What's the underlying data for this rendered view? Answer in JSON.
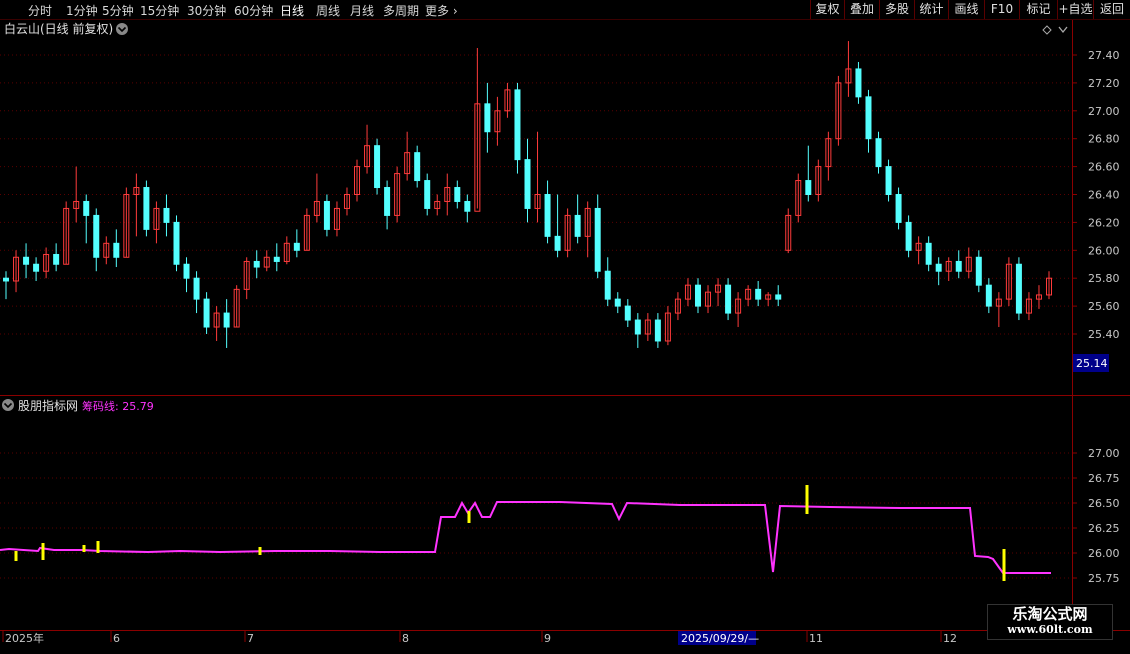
{
  "timeframes": [
    {
      "label": "分时",
      "active": false
    },
    {
      "label": "1分钟",
      "active": false
    },
    {
      "label": "5分钟",
      "active": false
    },
    {
      "label": "15分钟",
      "active": false
    },
    {
      "label": "30分钟",
      "active": false
    },
    {
      "label": "60分钟",
      "active": false
    },
    {
      "label": "日线",
      "active": true
    },
    {
      "label": "周线",
      "active": false
    },
    {
      "label": "月线",
      "active": false
    },
    {
      "label": "多周期",
      "active": false
    },
    {
      "label": "更多",
      "active": false
    }
  ],
  "toolbar": [
    "复权",
    "叠加",
    "多股",
    "统计",
    "画线",
    "F10",
    "标记",
    "+自选",
    "返回"
  ],
  "main_panel": {
    "title": "白云山(日线 前复权)",
    "price_tag": "25.14"
  },
  "indicator_panel": {
    "name": "股朋指标网",
    "series_label": "筹码线: 25.79"
  },
  "x_axis": {
    "labels": [
      "2025年",
      "6",
      "7",
      "8",
      "9",
      "2025/09/29/—",
      "11",
      "12"
    ]
  },
  "watermark": {
    "title": "乐淘公式网",
    "url": "www.60lt.com"
  },
  "colors": {
    "up": "#ff3b3b",
    "down": "#54ffff",
    "line": "#ff33ff",
    "signal": "#ffff00",
    "grid": "#5a0000"
  },
  "chart_data": [
    {
      "type": "candlestick",
      "title": "白云山(日线 前复权)",
      "y_ticks": [
        "25.40",
        "25.60",
        "25.80",
        "26.00",
        "26.20",
        "26.40",
        "26.60",
        "26.80",
        "27.00",
        "27.20",
        "27.40"
      ],
      "ylim": [
        25.14,
        27.55
      ],
      "candles": [
        [
          25.8,
          25.85,
          25.65,
          25.78
        ],
        [
          25.78,
          26.0,
          25.7,
          25.95
        ],
        [
          25.95,
          26.05,
          25.8,
          25.9
        ],
        [
          25.9,
          25.95,
          25.78,
          25.85
        ],
        [
          25.85,
          26.02,
          25.8,
          25.97
        ],
        [
          25.97,
          26.05,
          25.85,
          25.9
        ],
        [
          25.9,
          26.35,
          25.9,
          26.3
        ],
        [
          26.3,
          26.6,
          26.2,
          26.35
        ],
        [
          26.35,
          26.4,
          26.05,
          26.25
        ],
        [
          26.25,
          26.3,
          25.85,
          25.95
        ],
        [
          25.95,
          26.1,
          25.9,
          26.05
        ],
        [
          26.05,
          26.15,
          25.88,
          25.95
        ],
        [
          25.95,
          26.45,
          25.95,
          26.4
        ],
        [
          26.4,
          26.55,
          26.1,
          26.45
        ],
        [
          26.45,
          26.5,
          26.1,
          26.15
        ],
        [
          26.15,
          26.35,
          26.05,
          26.3
        ],
        [
          26.3,
          26.4,
          26.1,
          26.2
        ],
        [
          26.2,
          26.25,
          25.85,
          25.9
        ],
        [
          25.9,
          25.95,
          25.7,
          25.8
        ],
        [
          25.8,
          25.85,
          25.55,
          25.65
        ],
        [
          25.65,
          25.7,
          25.4,
          25.45
        ],
        [
          25.45,
          25.6,
          25.35,
          25.55
        ],
        [
          25.55,
          25.65,
          25.3,
          25.45
        ],
        [
          25.45,
          25.75,
          25.45,
          25.72
        ],
        [
          25.72,
          25.95,
          25.65,
          25.92
        ],
        [
          25.92,
          26.0,
          25.8,
          25.88
        ],
        [
          25.88,
          26.0,
          25.85,
          25.95
        ],
        [
          25.95,
          26.05,
          25.85,
          25.92
        ],
        [
          25.92,
          26.1,
          25.9,
          26.05
        ],
        [
          26.05,
          26.15,
          25.95,
          26.0
        ],
        [
          26.0,
          26.3,
          26.0,
          26.25
        ],
        [
          26.25,
          26.55,
          26.2,
          26.35
        ],
        [
          26.35,
          26.4,
          26.1,
          26.15
        ],
        [
          26.15,
          26.35,
          26.1,
          26.3
        ],
        [
          26.3,
          26.45,
          26.25,
          26.4
        ],
        [
          26.4,
          26.65,
          26.35,
          26.6
        ],
        [
          26.6,
          26.9,
          26.55,
          26.75
        ],
        [
          26.75,
          26.8,
          26.4,
          26.45
        ],
        [
          26.45,
          26.5,
          26.15,
          26.25
        ],
        [
          26.25,
          26.6,
          26.2,
          26.55
        ],
        [
          26.55,
          26.85,
          26.5,
          26.7
        ],
        [
          26.7,
          26.75,
          26.45,
          26.5
        ],
        [
          26.5,
          26.55,
          26.25,
          26.3
        ],
        [
          26.3,
          26.4,
          26.25,
          26.35
        ],
        [
          26.35,
          26.55,
          26.25,
          26.45
        ],
        [
          26.45,
          26.5,
          26.3,
          26.35
        ],
        [
          26.35,
          26.4,
          26.2,
          26.28
        ],
        [
          26.28,
          27.45,
          26.3,
          27.05
        ],
        [
          27.05,
          27.2,
          26.7,
          26.85
        ],
        [
          26.85,
          27.1,
          26.75,
          27.0
        ],
        [
          27.0,
          27.2,
          26.95,
          27.15
        ],
        [
          27.15,
          27.2,
          26.55,
          26.65
        ],
        [
          26.65,
          26.8,
          26.2,
          26.3
        ],
        [
          26.3,
          26.85,
          26.2,
          26.4
        ],
        [
          26.4,
          26.5,
          26.05,
          26.1
        ],
        [
          26.1,
          26.4,
          25.95,
          26.0
        ],
        [
          26.0,
          26.3,
          25.95,
          26.25
        ],
        [
          26.25,
          26.4,
          26.05,
          26.1
        ],
        [
          26.1,
          26.35,
          25.95,
          26.3
        ],
        [
          26.3,
          26.4,
          25.8,
          25.85
        ],
        [
          25.85,
          25.95,
          25.6,
          25.65
        ],
        [
          25.65,
          25.7,
          25.55,
          25.6
        ],
        [
          25.6,
          25.65,
          25.45,
          25.5
        ],
        [
          25.5,
          25.55,
          25.3,
          25.4
        ],
        [
          25.4,
          25.55,
          25.35,
          25.5
        ],
        [
          25.5,
          25.55,
          25.3,
          25.35
        ],
        [
          25.35,
          25.6,
          25.32,
          25.55
        ],
        [
          25.55,
          25.7,
          25.5,
          25.65
        ],
        [
          25.65,
          25.8,
          25.6,
          25.75
        ],
        [
          25.75,
          25.8,
          25.55,
          25.6
        ],
        [
          25.6,
          25.75,
          25.55,
          25.7
        ],
        [
          25.7,
          25.8,
          25.6,
          25.75
        ],
        [
          25.75,
          25.8,
          25.5,
          25.55
        ],
        [
          25.55,
          25.7,
          25.45,
          25.65
        ],
        [
          25.65,
          25.75,
          25.6,
          25.72
        ],
        [
          25.72,
          25.78,
          25.6,
          25.65
        ],
        [
          25.65,
          25.7,
          25.6,
          25.68
        ],
        [
          25.68,
          25.75,
          25.6,
          25.65
        ],
        [
          26.0,
          26.3,
          25.98,
          26.25
        ],
        [
          26.25,
          26.55,
          26.2,
          26.5
        ],
        [
          26.5,
          26.75,
          26.35,
          26.4
        ],
        [
          26.4,
          26.65,
          26.35,
          26.6
        ],
        [
          26.6,
          26.85,
          26.5,
          26.8
        ],
        [
          26.8,
          27.25,
          26.75,
          27.2
        ],
        [
          27.2,
          27.5,
          27.1,
          27.3
        ],
        [
          27.3,
          27.35,
          27.05,
          27.1
        ],
        [
          27.1,
          27.15,
          26.7,
          26.8
        ],
        [
          26.8,
          26.85,
          26.55,
          26.6
        ],
        [
          26.6,
          26.65,
          26.35,
          26.4
        ],
        [
          26.4,
          26.45,
          26.15,
          26.2
        ],
        [
          26.2,
          26.25,
          25.95,
          26.0
        ],
        [
          26.0,
          26.1,
          25.9,
          26.05
        ],
        [
          26.05,
          26.1,
          25.85,
          25.9
        ],
        [
          25.9,
          25.95,
          25.75,
          25.85
        ],
        [
          25.85,
          25.95,
          25.78,
          25.92
        ],
        [
          25.92,
          26.0,
          25.8,
          25.85
        ],
        [
          25.85,
          26.02,
          25.8,
          25.95
        ],
        [
          25.95,
          26.0,
          25.7,
          25.75
        ],
        [
          25.75,
          25.8,
          25.55,
          25.6
        ],
        [
          25.6,
          25.7,
          25.45,
          25.65
        ],
        [
          25.65,
          25.95,
          25.6,
          25.9
        ],
        [
          25.9,
          25.95,
          25.5,
          25.55
        ],
        [
          25.55,
          25.7,
          25.5,
          25.65
        ],
        [
          25.65,
          25.75,
          25.58,
          25.68
        ],
        [
          25.68,
          25.85,
          25.65,
          25.8
        ]
      ]
    },
    {
      "type": "line",
      "title": "股朋指标网",
      "y_ticks": [
        "25.75",
        "26.00",
        "26.25",
        "26.50",
        "26.75",
        "27.00"
      ],
      "ylim": [
        25.5,
        27.3
      ],
      "series": [
        {
          "name": "筹码线",
          "points": [
            [
              0,
              26.03
            ],
            [
              9,
              26.04
            ],
            [
              38,
              26.02
            ],
            [
              40,
              26.05
            ],
            [
              54,
              26.03
            ],
            [
              82,
              26.03
            ],
            [
              100,
              26.02
            ],
            [
              148,
              26.01
            ],
            [
              180,
              26.02
            ],
            [
              220,
              26.01
            ],
            [
              275,
              26.02
            ],
            [
              330,
              26.02
            ],
            [
              380,
              26.01
            ],
            [
              420,
              26.01
            ],
            [
              435,
              26.01
            ],
            [
              441,
              26.36
            ],
            [
              455,
              26.36
            ],
            [
              462,
              26.5
            ],
            [
              468,
              26.4
            ],
            [
              475,
              26.5
            ],
            [
              482,
              26.36
            ],
            [
              490,
              26.36
            ],
            [
              497,
              26.51
            ],
            [
              560,
              26.51
            ],
            [
              612,
              26.49
            ],
            [
              619,
              26.34
            ],
            [
              627,
              26.5
            ],
            [
              680,
              26.48
            ],
            [
              765,
              26.48
            ],
            [
              773,
              25.81
            ],
            [
              780,
              26.47
            ],
            [
              830,
              26.46
            ],
            [
              900,
              26.45
            ],
            [
              970,
              26.45
            ],
            [
              975,
              25.97
            ],
            [
              988,
              25.96
            ],
            [
              993,
              25.94
            ],
            [
              1003,
              25.8
            ],
            [
              1051,
              25.8
            ]
          ]
        }
      ],
      "signals": [
        [
          16,
          25.92,
          26.02
        ],
        [
          43,
          25.93,
          26.1
        ],
        [
          84,
          26.01,
          26.08
        ],
        [
          98,
          26.0,
          26.12
        ],
        [
          260,
          25.98,
          26.06
        ],
        [
          469,
          26.3,
          26.42
        ],
        [
          807,
          26.39,
          26.68
        ],
        [
          1004,
          25.72,
          26.04
        ]
      ]
    }
  ]
}
